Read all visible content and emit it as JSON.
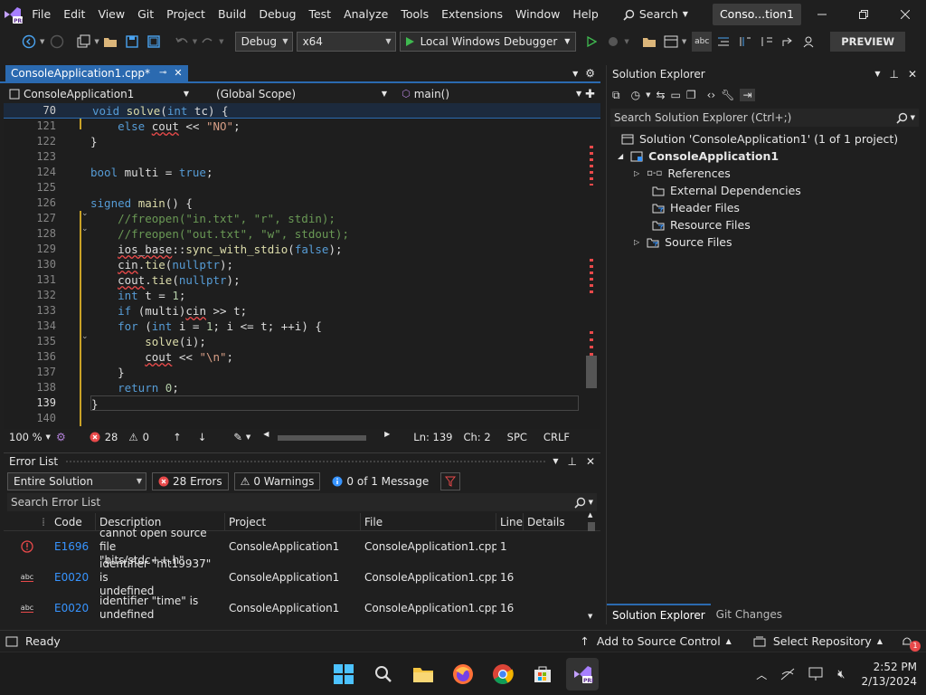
{
  "menubar": {
    "items": [
      "File",
      "Edit",
      "View",
      "Git",
      "Project",
      "Build",
      "Debug",
      "Test",
      "Analyze",
      "Tools",
      "Extensions",
      "Window",
      "Help"
    ],
    "search_label": "Search",
    "solution_name": "Conso...tion1"
  },
  "toolbar": {
    "config": "Debug",
    "platform": "x64",
    "run_label": "Local Windows Debugger",
    "preview_label": "PREVIEW"
  },
  "editor": {
    "tab_label": "ConsoleApplication1.cpp*",
    "project_combo": "ConsoleApplication1",
    "scope_combo": "(Global Scope)",
    "member_combo": "main()",
    "sticky_line_number": "70",
    "sticky_line_code": "void solve(int tc) {",
    "line_numbers": [
      "121",
      "122",
      "123",
      "124",
      "125",
      "126",
      "127",
      "128",
      "129",
      "130",
      "131",
      "132",
      "133",
      "134",
      "135",
      "136",
      "137",
      "138",
      "139",
      "140"
    ]
  },
  "edstatus": {
    "zoom": "100 %",
    "errors": "28",
    "warnings": "0",
    "line": "Ln: 139",
    "col": "Ch: 2",
    "spc": "SPC",
    "crlf": "CRLF"
  },
  "errorlist": {
    "title": "Error List",
    "scope": "Entire Solution",
    "errors_btn": "28 Errors",
    "warnings_btn": "0 Warnings",
    "messages_btn": "0 of 1 Message",
    "search_placeholder": "Search Error List",
    "columns": [
      "Code",
      "Description",
      "Project",
      "File",
      "Line",
      "Details"
    ],
    "rows": [
      {
        "code": "E1696",
        "desc1": "cannot open source file",
        "desc2": "\"bits/stdc++.h\"",
        "project": "ConsoleApplication1",
        "file": "ConsoleApplication1.cpp",
        "line": "1"
      },
      {
        "code": "E0020",
        "desc1": "identifier \"mt19937\" is",
        "desc2": "undefined",
        "project": "ConsoleApplication1",
        "file": "ConsoleApplication1.cpp",
        "line": "16"
      },
      {
        "code": "E0020",
        "desc1": "identifier \"time\" is",
        "desc2": "undefined",
        "project": "ConsoleApplication1",
        "file": "ConsoleApplication1.cpp",
        "line": "16"
      }
    ]
  },
  "solex": {
    "title": "Solution Explorer",
    "search_placeholder": "Search Solution Explorer (Ctrl+;)",
    "solution_line": "Solution 'ConsoleApplication1' (1 of 1 project)",
    "project": "ConsoleApplication1",
    "items": [
      "References",
      "External Dependencies",
      "Header Files",
      "Resource Files",
      "Source Files"
    ],
    "tab_active": "Solution Explorer",
    "tab_other": "Git Changes"
  },
  "statusbar": {
    "ready": "Ready",
    "source_control": "Add to Source Control",
    "repository": "Select Repository",
    "notif_count": "1"
  },
  "taskbar": {
    "time": "2:52 PM",
    "date": "2/13/2024"
  },
  "colors": {
    "accent": "#2b6ab0",
    "error": "#e8494a",
    "keyword": "#569cd6",
    "comment": "#6a9955",
    "string": "#d69d85"
  }
}
